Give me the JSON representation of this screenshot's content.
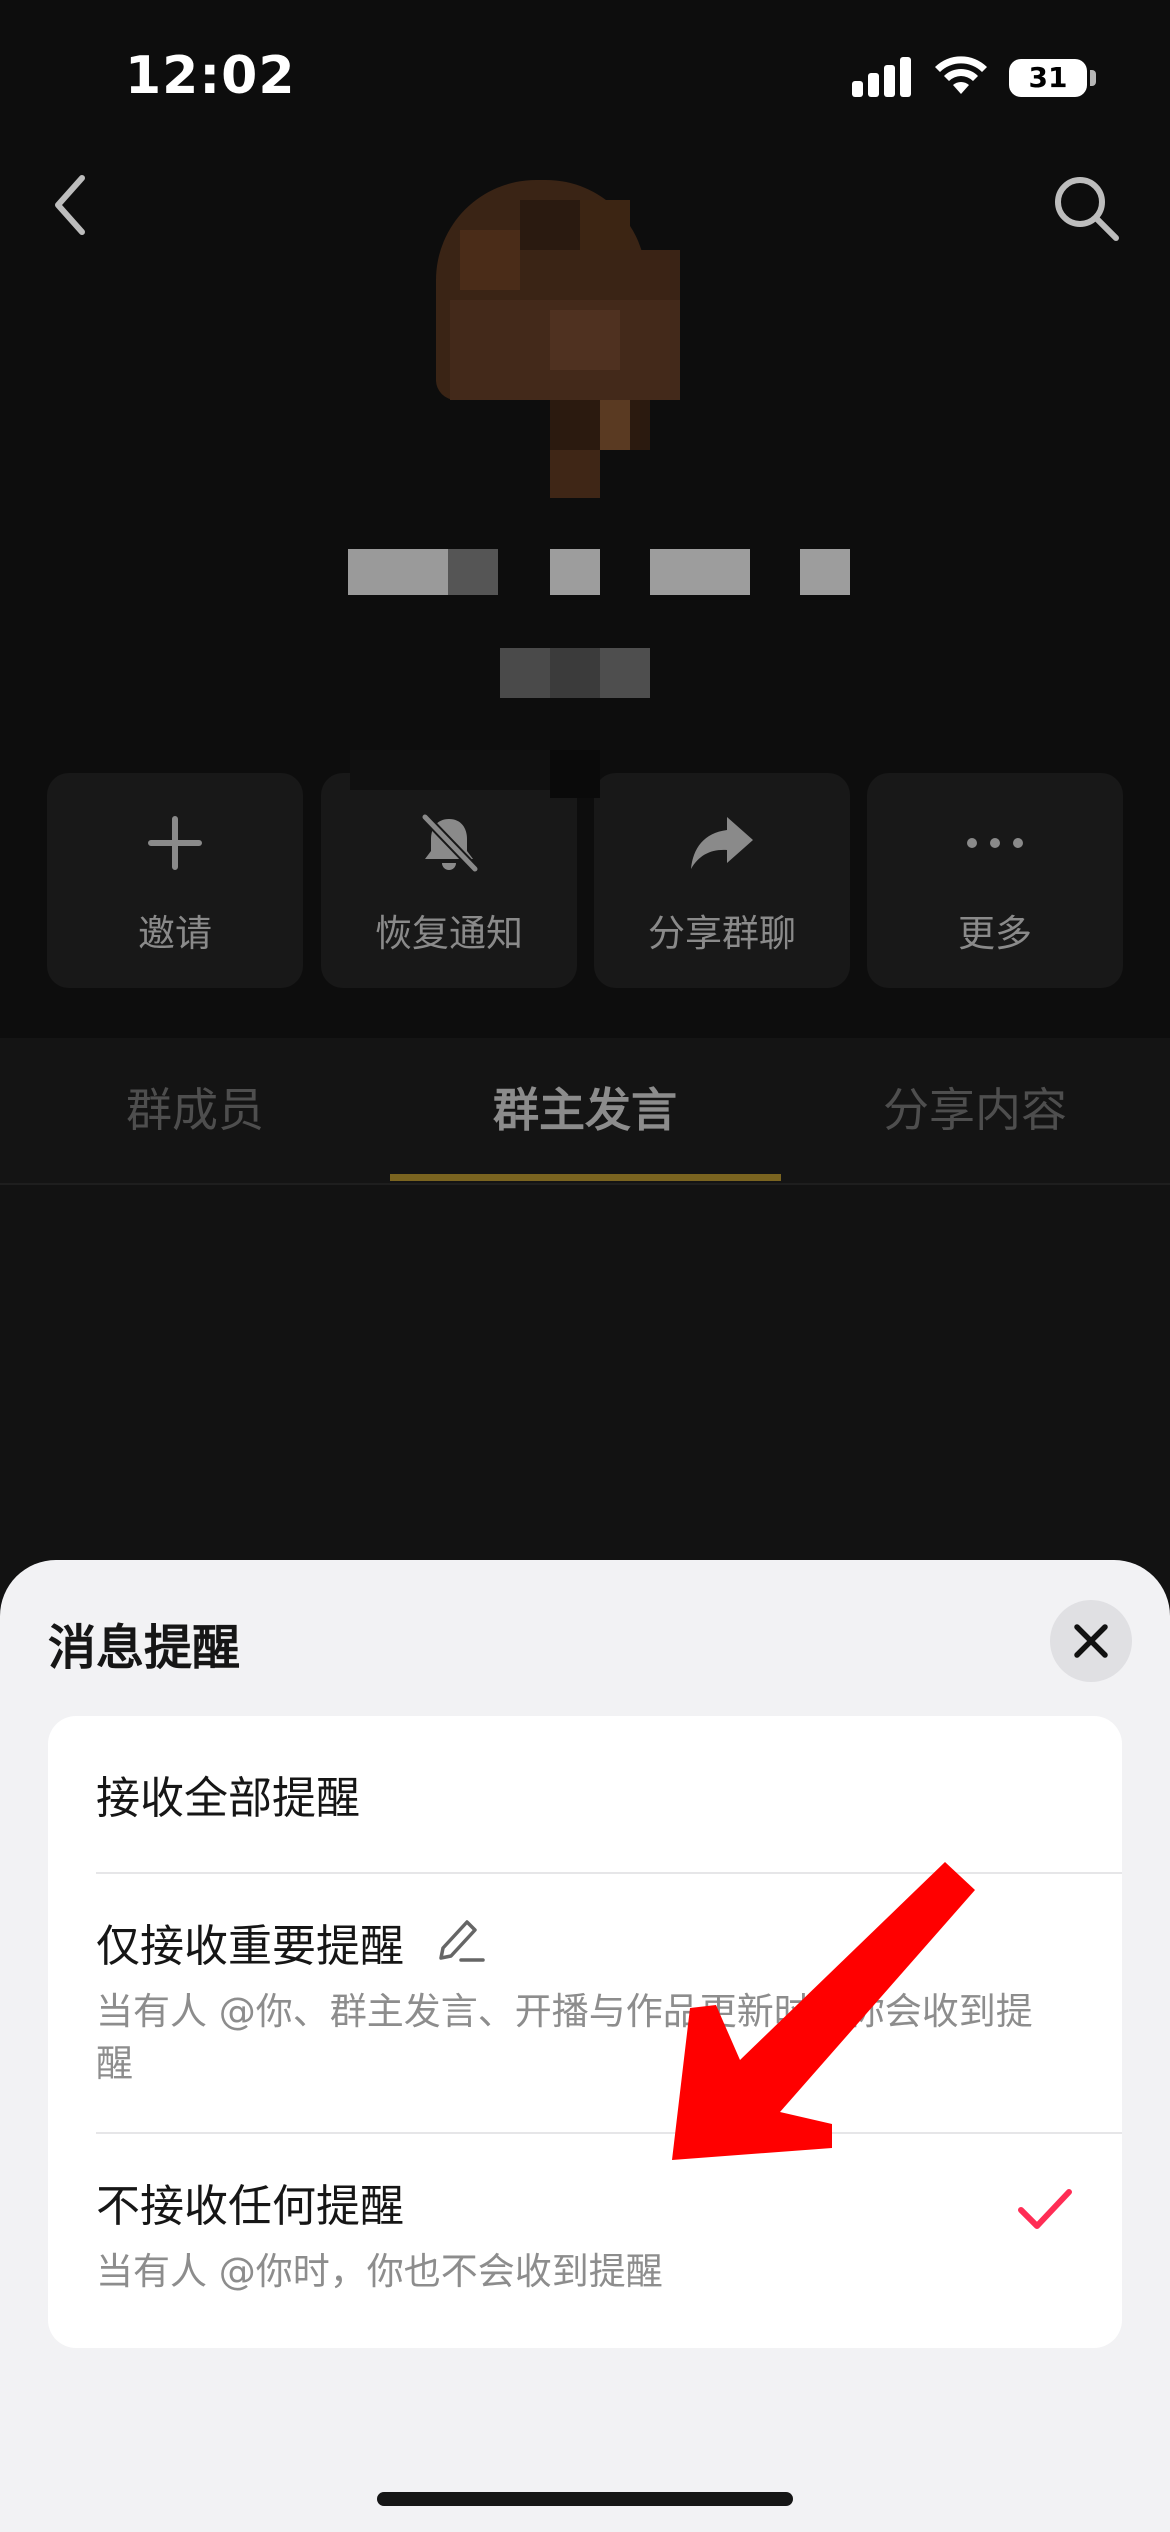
{
  "status_bar": {
    "time": "12:02",
    "battery": "31"
  },
  "header": {
    "back_icon": "chevron-left-icon",
    "search_icon": "search-icon"
  },
  "actions": [
    {
      "label": "邀请",
      "icon": "plus-icon"
    },
    {
      "label": "恢复通知",
      "icon": "bell-off-icon"
    },
    {
      "label": "分享群聊",
      "icon": "share-arrow-icon"
    },
    {
      "label": "更多",
      "icon": "more-dots-icon"
    }
  ],
  "tabs": [
    {
      "label": "群成员",
      "active": false
    },
    {
      "label": "群主发言",
      "active": true
    },
    {
      "label": "分享内容",
      "active": false
    }
  ],
  "sheet": {
    "title": "消息提醒",
    "close_icon": "close-icon",
    "options": [
      {
        "title": "接收全部提醒",
        "description": "",
        "selected": false
      },
      {
        "title": "仅接收重要提醒",
        "description": "当有人 @你、群主发言、开播与作品更新时，你会收到提醒",
        "selected": false,
        "icon": "edit-pencil-icon"
      },
      {
        "title": "不接收任何提醒",
        "description": "当有人 @你时，你也不会收到提醒",
        "selected": true,
        "icon": "checkmark-icon"
      }
    ]
  },
  "colors": {
    "accent": "#ff2d55",
    "tab_underline": "#7a6420",
    "annotation_arrow": "#ff0000"
  }
}
